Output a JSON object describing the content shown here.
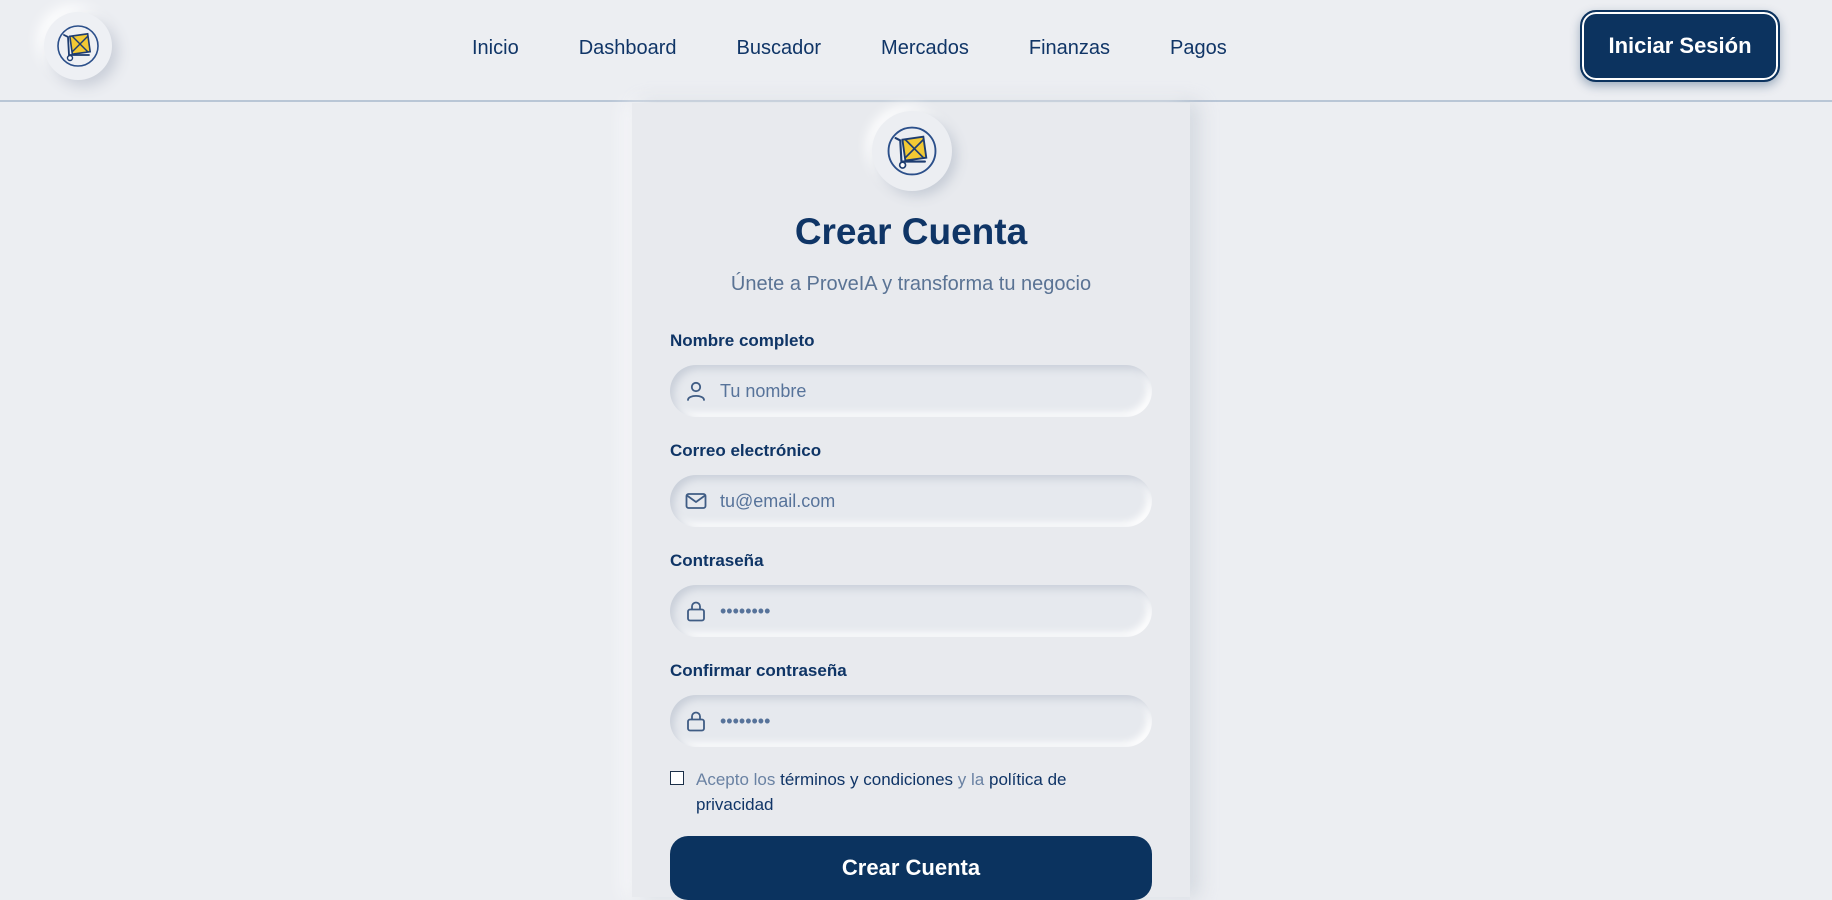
{
  "nav": {
    "logo_icon": "cart-crate-icon",
    "links": [
      "Inicio",
      "Dashboard",
      "Buscador",
      "Mercados",
      "Finanzas",
      "Pagos"
    ],
    "login_label": "Iniciar Sesión"
  },
  "card": {
    "logo_icon": "cart-crate-icon",
    "title": "Crear Cuenta",
    "subtitle": "Únete a ProveIA y transforma tu negocio",
    "fields": [
      {
        "label": "Nombre completo",
        "placeholder": "Tu nombre",
        "value": "",
        "icon": "user-icon"
      },
      {
        "label": "Correo electrónico",
        "placeholder": "tu@email.com",
        "value": "",
        "icon": "mail-icon"
      },
      {
        "label": "Contraseña",
        "placeholder": "••••••••",
        "value": "",
        "icon": "lock-icon"
      },
      {
        "label": "Confirmar contraseña",
        "placeholder": "••••••••",
        "value": "",
        "icon": "lock-icon"
      }
    ],
    "terms": {
      "prefix": "Acepto los",
      "terms_link": "términos y condiciones",
      "middle": "y la",
      "privacy_link": "política de privacidad",
      "checked": false
    },
    "submit_label": "Crear Cuenta"
  },
  "colors": {
    "primary": "#0c335f",
    "background": "#eceef2",
    "text_muted": "#5a7394",
    "logo_yellow": "#f2c933"
  }
}
